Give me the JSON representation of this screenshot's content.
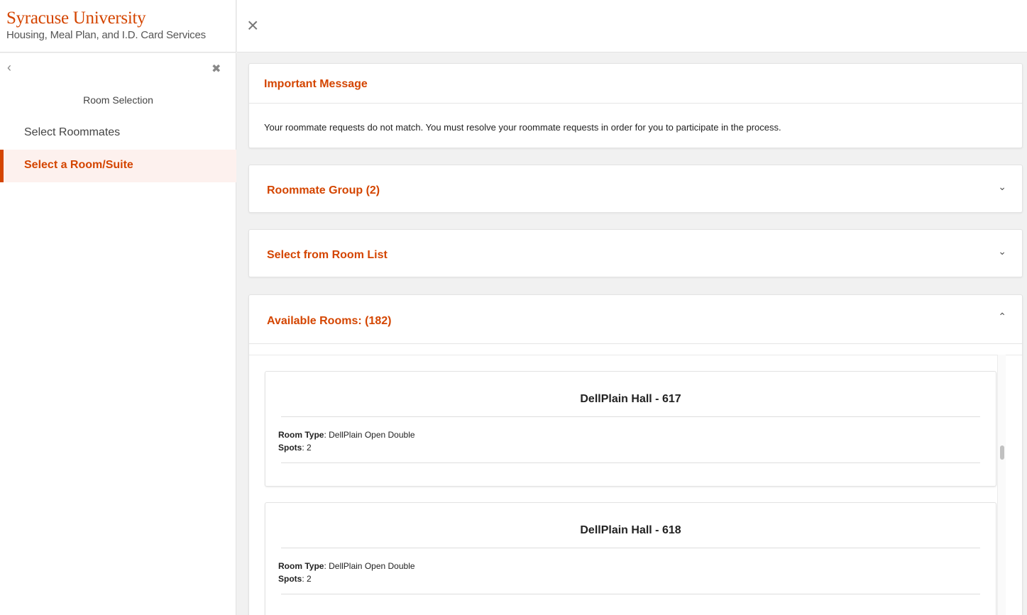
{
  "brand": {
    "name": "Syracuse University",
    "subtitle": "Housing, Meal Plan, and I.D. Card Services"
  },
  "topbar": {
    "close_glyph": "×"
  },
  "sidebar": {
    "back_glyph": "‹",
    "close_glyph": "✖",
    "title": "Room Selection",
    "items": [
      {
        "label": "Select Roommates",
        "active": false
      },
      {
        "label": "Select a Room/Suite",
        "active": true
      }
    ]
  },
  "message": {
    "title": "Important Message",
    "body": "Your roommate requests do not match. You must resolve your roommate requests in order for you to participate in the process."
  },
  "accordions": [
    {
      "title": "Roommate Group (2)",
      "expanded": false,
      "chevron": "⌄"
    },
    {
      "title": "Select from Room List",
      "expanded": false,
      "chevron": "⌄"
    },
    {
      "title": "Available Rooms: (182)",
      "expanded": true,
      "chevron": "⌃"
    }
  ],
  "rooms": [
    {
      "name": "DellPlain Hall - 617",
      "type_label": "Room Type",
      "type_value": "DellPlain Open Double",
      "spots_label": "Spots",
      "spots_value": "2"
    },
    {
      "name": "DellPlain Hall - 618",
      "type_label": "Room Type",
      "type_value": "DellPlain Open Double",
      "spots_label": "Spots",
      "spots_value": "2"
    }
  ],
  "colors": {
    "accent": "#d44500",
    "active_bg": "#fdf1ee"
  }
}
